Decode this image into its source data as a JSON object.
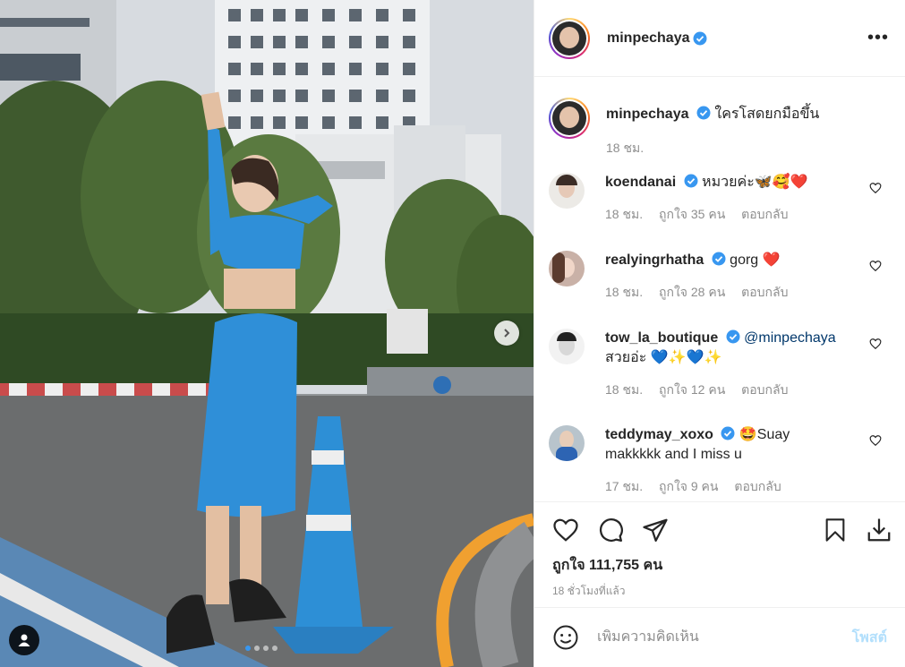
{
  "post": {
    "username": "minpechaya",
    "more_label": "•••",
    "caption": "ใครโสดยกมือขึ้น",
    "caption_time": "18 ชม.",
    "likes": "ถูกใจ 111,755 คน",
    "time_ago": "18 ชั่วโมงที่แล้ว",
    "carousel_total": 4,
    "carousel_active": 1
  },
  "comments": [
    {
      "user": "koendanai",
      "verified": true,
      "text": "หมวยค่ะ🦋🥰❤️",
      "time": "18 ชม.",
      "likes": "ถูกใจ 35 คน",
      "reply": "ตอบกลับ"
    },
    {
      "user": "realyingrhatha",
      "verified": true,
      "text": "gorg ❤️",
      "time": "18 ชม.",
      "likes": "ถูกใจ 28 คน",
      "reply": "ตอบกลับ"
    },
    {
      "user": "tow_la_boutique",
      "verified": true,
      "mention": "@minpechaya",
      "text": "สวยอ่ะ 💙✨💙✨",
      "time": "18 ชม.",
      "likes": "ถูกใจ 12 คน",
      "reply": "ตอบกลับ"
    },
    {
      "user": "teddymay_xoxo",
      "verified": true,
      "text": "🤩Suay",
      "text2": "makkkkk and I miss u",
      "time": "17 ชม.",
      "likes": "ถูกใจ 9 คน",
      "reply": "ตอบกลับ"
    }
  ],
  "composer": {
    "placeholder": "เพิ่มความคิดเห็น",
    "post_label": "โพสต์"
  },
  "icons": {
    "verified_color": "#3897f0",
    "heart": "heart-icon",
    "comment": "comment-icon",
    "share": "share-icon",
    "save": "bookmark-icon",
    "download": "download-icon",
    "emoji": "emoji-icon",
    "next": "chevron-right-icon",
    "tag": "user-tag-icon"
  }
}
